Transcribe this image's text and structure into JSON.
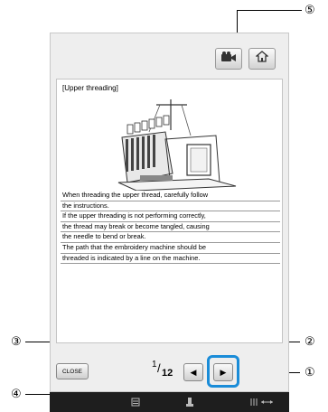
{
  "callouts": {
    "c1": "①",
    "c2": "②",
    "c3": "③",
    "c4": "④",
    "c5": "⑤"
  },
  "document": {
    "title": "[Upper threading]",
    "lines": [
      " When threading the upper thread, carefully follow",
      "the instructions.",
      " If the upper threading is not performing correctly,",
      "the thread may break or become tangled, causing",
      "the needle to bend or break.",
      " The path that the embroidery machine should be",
      "threaded is indicated by a line on the machine."
    ]
  },
  "buttons": {
    "close": "CLOSE",
    "prev_arrow": "◀",
    "next_arrow": "▶"
  },
  "pagination": {
    "current": "1",
    "separator": "/",
    "total": "12"
  },
  "colors": {
    "highlight": "#1a8cd8",
    "bottom_bar": "#1e1e1e"
  },
  "icons": {
    "video": "video-camera-icon",
    "home": "home-icon"
  }
}
